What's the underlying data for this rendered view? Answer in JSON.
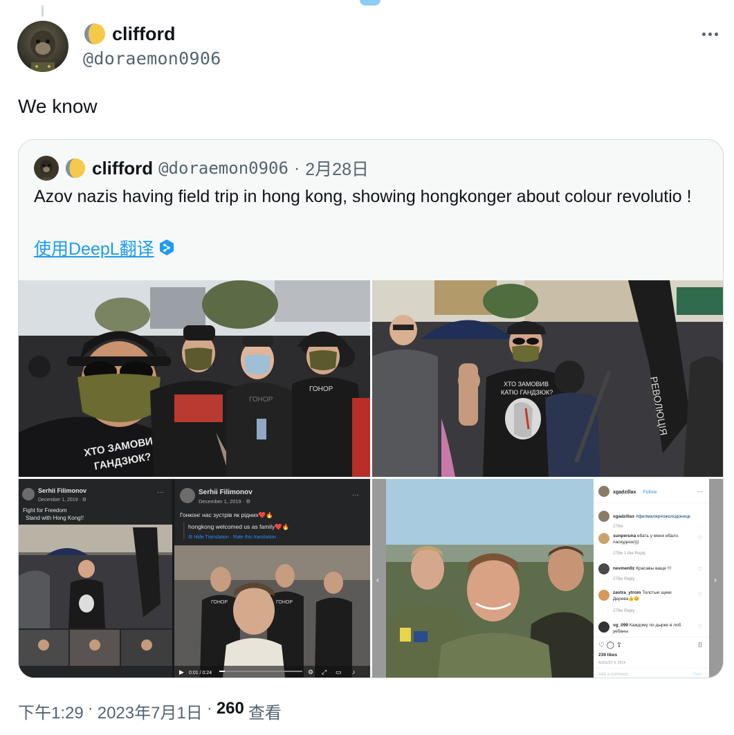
{
  "author": {
    "name": "clifford",
    "handle": "@doraemon0906"
  },
  "tweet": {
    "text": "We know",
    "time": "下午1:29",
    "date": "2023年7月1日",
    "views_count": "260",
    "views_label": "查看",
    "separator": "·"
  },
  "quote": {
    "name": "clifford",
    "handle": "@doraemon0906",
    "dot": "·",
    "date": "2月28日",
    "text": "Azov nazis having field trip in hong kong, showing hongkonger about colour revolutio !",
    "translate_label": "使用DeepL翻译"
  },
  "photos": {
    "p1": {
      "shirt_text": "ХТО ЗАМОВИВ\nГАНДЗЮК?",
      "shirt2": "ГОНОР",
      "shirt3": "ГОНОР"
    },
    "p2": {
      "shirt_text_1": "ХТО ЗАМОВИВ",
      "shirt_text_2": "КАТЮ ГАНДЗЮК?"
    },
    "p3": {
      "left_name": "Serhii Filimonov",
      "left_date": "December 1, 2019 · ",
      "left_line1": "Fight for Freedom",
      "left_line2": "Stand with Hong Kong!!",
      "right_name": "Serhii Filimonov",
      "right_date": "December 1, 2019 · ",
      "right_line1": "Гонконг нас зустрів як рідних❤️🔥",
      "right_line2": "hongkong welcomed us as family❤️🔥",
      "right_link": "Hide Translation · Rate this translation",
      "video_time": "0:01 / 0:24"
    },
    "p4": {
      "user": "xgadzillax",
      "follow": "· Follow",
      "comments": [
        {
          "user": "xgadzillax",
          "text": "#филмаляр#ожолодонецк",
          "meta": "278w"
        },
        {
          "user": "sunperuna",
          "text": "ебать у меня ебало паскудное)))",
          "meta": "278w   1 like   Reply"
        },
        {
          "user": "nevmen0z",
          "text": "Красавы ваще !!!",
          "meta": "278w   Reply"
        },
        {
          "user": "zavtra_ytrom",
          "text": "Толстые щеки Дерева👍😊",
          "meta": "278w   Reply"
        },
        {
          "user": "vg_099",
          "text": "Каждому по дырке в лоб уебаны",
          "meta": ""
        }
      ],
      "likes": "239 likes",
      "posted": "AUGUST 4, 2014",
      "add_comment": "Add a comment...",
      "post": "Post"
    }
  },
  "colors": {
    "link": "#1d9bf0",
    "muted": "#536471",
    "border": "#cfd9de"
  },
  "icons": {
    "more": "more-horizontal-icon",
    "moon": "moon-emoji-icon",
    "deepl": "deepl-icon"
  }
}
